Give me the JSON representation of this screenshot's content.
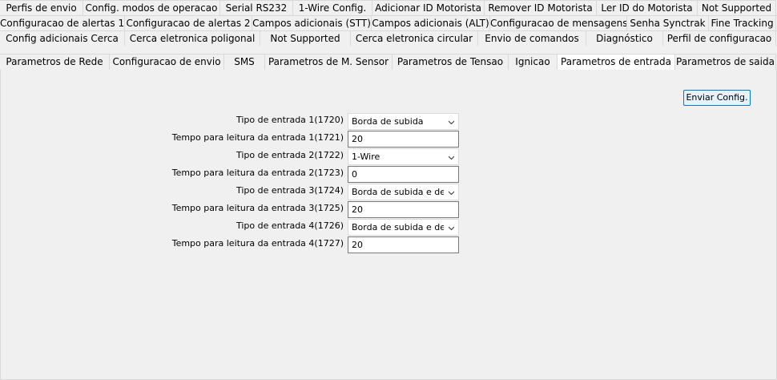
{
  "tabs": {
    "row1": [
      "Perfis de envio",
      "Config. modos de operacao",
      "Serial RS232",
      "1-Wire Config.",
      "Adicionar ID Motorista",
      "Remover ID Motorista",
      "Ler ID do Motorista",
      "Not Supported"
    ],
    "row2": [
      "Configuracao de alertas 1",
      "Configuracao de alertas 2",
      "Campos adicionais (STT)",
      "Campos adicionais (ALT)",
      "Configuracao de mensagens",
      "Senha Synctrak",
      "Fine Tracking"
    ],
    "row3": [
      "Config adicionais Cerca",
      "Cerca eletronica poligonal",
      "Not Supported",
      "Cerca eletronica circular",
      "Envio de comandos",
      "Diagnóstico",
      "Perfil de configuracao"
    ],
    "row4": [
      "Parametros de Rede",
      "Configuracao de envio",
      "SMS",
      "Parametros de M. Sensor",
      "Parametros de Tensao",
      "Ignicao",
      "Parametros de entrada",
      "Parametros de saida"
    ],
    "active": "Parametros de entrada"
  },
  "send_button": "Enviar Config.",
  "form": [
    {
      "label": "Tipo de entrada 1(1720)",
      "type": "select",
      "value": "Borda de subida"
    },
    {
      "label": "Tempo para leitura da entrada 1(1721)",
      "type": "input",
      "value": "20"
    },
    {
      "label": "Tipo de entrada 2(1722)",
      "type": "select",
      "value": "1-Wire"
    },
    {
      "label": "Tempo para leitura da entrada 2(1723)",
      "type": "input",
      "value": "0"
    },
    {
      "label": "Tipo de entrada 3(1724)",
      "type": "select",
      "value": "Borda de subida e desc"
    },
    {
      "label": "Tempo para leitura da entrada 3(1725)",
      "type": "input",
      "value": "20"
    },
    {
      "label": "Tipo de entrada 4(1726)",
      "type": "select",
      "value": "Borda de subida e desc"
    },
    {
      "label": "Tempo para leitura da entrada 4(1727)",
      "type": "input",
      "value": "20"
    }
  ]
}
